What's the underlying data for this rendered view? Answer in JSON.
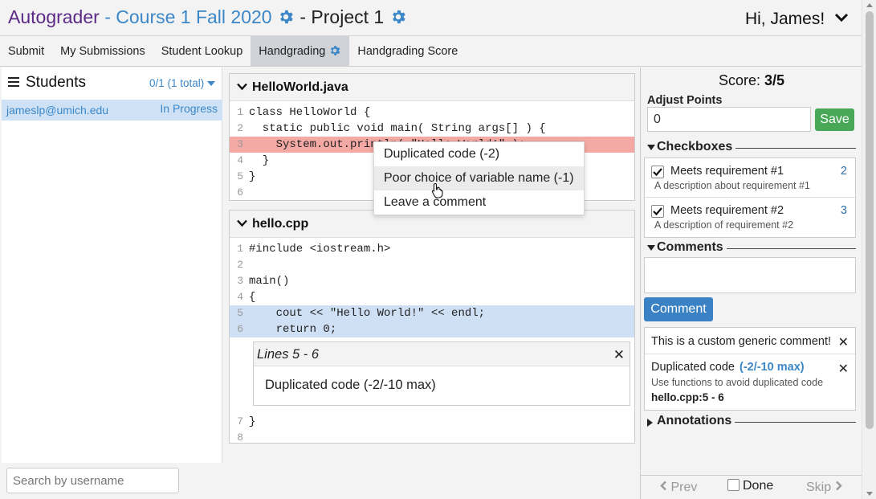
{
  "header": {
    "app_name": "Autograder",
    "course": "- Course 1 Fall 2020",
    "project": "- Project 1",
    "greeting": "Hi, James!"
  },
  "tabs": [
    {
      "label": "Submit"
    },
    {
      "label": "My Submissions"
    },
    {
      "label": "Student Lookup"
    },
    {
      "label": "Handgrading"
    },
    {
      "label": "Handgrading Score"
    }
  ],
  "students": {
    "title": "Students",
    "count": "0/1 (1 total)",
    "rows": [
      {
        "username": "jameslp@umich.edu",
        "status": "In Progress"
      }
    ],
    "search_placeholder": "Search by username"
  },
  "files": [
    {
      "name": "HelloWorld.java",
      "lines": [
        {
          "n": "1",
          "code": "class HelloWorld {"
        },
        {
          "n": "2",
          "code": "  static public void main( String args[] ) {"
        },
        {
          "n": "3",
          "code": "    System.out.println( \"Hello World!\" );"
        },
        {
          "n": "4",
          "code": "  }"
        },
        {
          "n": "5",
          "code": "}"
        },
        {
          "n": "6",
          "code": ""
        }
      ]
    },
    {
      "name": "hello.cpp",
      "lines": [
        {
          "n": "1",
          "code": "#include <iostream.h>"
        },
        {
          "n": "2",
          "code": ""
        },
        {
          "n": "3",
          "code": "main()"
        },
        {
          "n": "4",
          "code": "{"
        },
        {
          "n": "5",
          "code": "    cout << \"Hello World!\" << endl;"
        },
        {
          "n": "6",
          "code": "    return 0;"
        },
        {
          "n": "7",
          "code": "}"
        },
        {
          "n": "8",
          "code": ""
        }
      ],
      "comment": {
        "lines_label": "Lines 5 - 6",
        "text": "Duplicated code (-2/-10 max)"
      }
    }
  ],
  "context_menu": [
    {
      "label": "Duplicated code (-2)"
    },
    {
      "label": "Poor choice of variable name (-1)"
    },
    {
      "label": "Leave a comment"
    }
  ],
  "grading": {
    "score_label": "Score:",
    "score_value": "3/5",
    "adjust_label": "Adjust Points",
    "adjust_value": "0",
    "save_label": "Save",
    "checkboxes_title": "Checkboxes",
    "checkboxes": [
      {
        "name": "Meets requirement #1",
        "points": "2",
        "description": "A description about requirement #1"
      },
      {
        "name": "Meets requirement #2",
        "points": "3",
        "description": "A description of requirement #2"
      }
    ],
    "comments_title": "Comments",
    "comment_button": "Comment",
    "comments": [
      {
        "text": "This is a custom generic comment!"
      },
      {
        "text": "Duplicated code",
        "points": "(-2/-10 max)",
        "description": "Use functions to avoid duplicated code",
        "location": "hello.cpp:5 - 6"
      }
    ],
    "annotations_title": "Annotations",
    "prev_label": "Prev",
    "done_label": "Done",
    "skip_label": "Skip"
  },
  "colors": {
    "brand": "#5b2a86",
    "link": "#3b87c8",
    "save": "#48a858",
    "comment_button": "#3b82c4",
    "error_line": "#f5a9a4",
    "highlight_line": "#cfe0f4"
  }
}
